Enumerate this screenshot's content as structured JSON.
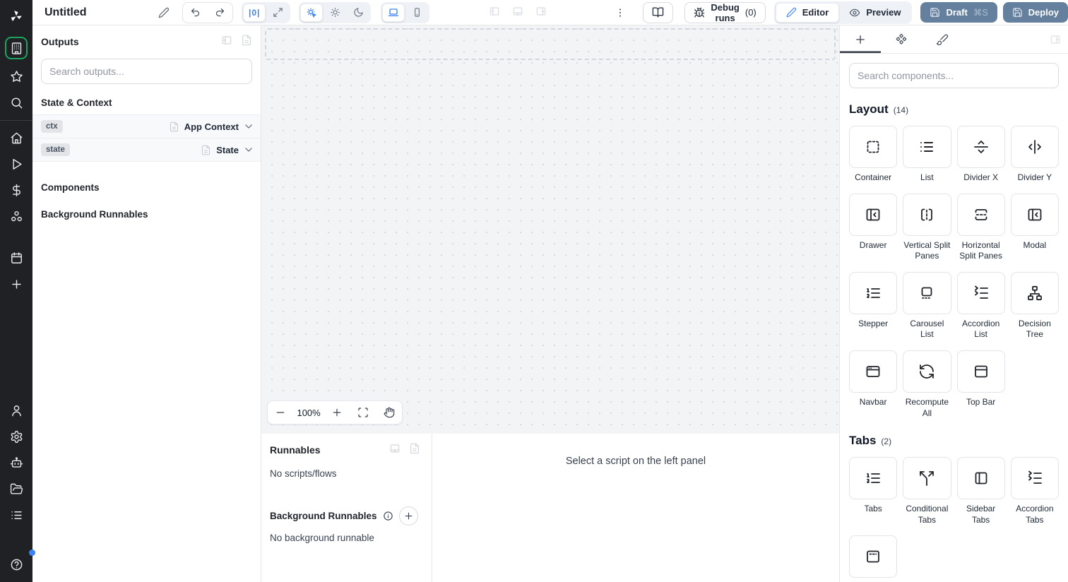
{
  "topbar": {
    "title": "Untitled",
    "zoom_width_label": "|0|",
    "debug_runs_label": "Debug runs",
    "debug_runs_count": "(0)",
    "editor_label": "Editor",
    "preview_label": "Preview",
    "draft_label": "Draft",
    "draft_shortcut": "⌘S",
    "deploy_label": "Deploy"
  },
  "rail": {
    "accent_green": "#1ba45f",
    "top": [
      {
        "icon": "building",
        "name": "apps",
        "active": true
      },
      {
        "icon": "star",
        "name": "favorites"
      },
      {
        "icon": "search",
        "name": "search"
      }
    ],
    "main": [
      {
        "icon": "home",
        "name": "home"
      },
      {
        "icon": "play",
        "name": "runs"
      },
      {
        "icon": "dollar",
        "name": "variables"
      },
      {
        "icon": "resources",
        "name": "resources"
      }
    ],
    "secondary": [
      {
        "icon": "calendar",
        "name": "schedules"
      },
      {
        "icon": "plus",
        "name": "more-triggers"
      }
    ],
    "bottom": [
      {
        "icon": "user",
        "name": "account"
      },
      {
        "icon": "gear",
        "name": "settings"
      },
      {
        "icon": "bot",
        "name": "ai"
      },
      {
        "icon": "folder",
        "name": "folders"
      },
      {
        "icon": "list",
        "name": "workers"
      }
    ],
    "help": {
      "icon": "help",
      "name": "help",
      "notification_dot": true
    }
  },
  "outputs": {
    "title": "Outputs",
    "search_placeholder": "Search outputs...",
    "state_context_heading": "State & Context",
    "rows": [
      {
        "badge": "ctx",
        "type": "App Context"
      },
      {
        "badge": "state",
        "type": "State"
      }
    ],
    "components_heading": "Components",
    "background_heading": "Background Runnables"
  },
  "canvas": {
    "zoom_level": "100%"
  },
  "runnables": {
    "title": "Runnables",
    "empty": "No scripts/flows",
    "background_title": "Background Runnables",
    "background_empty": "No background runnable",
    "hint": "Select a script on the left panel"
  },
  "components_panel": {
    "search_placeholder": "Search components...",
    "sections": [
      {
        "title": "Layout",
        "count": "(14)",
        "items": [
          {
            "label": "Container",
            "icon": "container"
          },
          {
            "label": "List",
            "icon": "list"
          },
          {
            "label": "Divider X",
            "icon": "divider-x"
          },
          {
            "label": "Divider Y",
            "icon": "divider-y"
          },
          {
            "label": "Drawer",
            "icon": "drawer"
          },
          {
            "label": "Vertical Split Panes",
            "icon": "vertical-split"
          },
          {
            "label": "Horizontal Split Panes",
            "icon": "horizontal-split"
          },
          {
            "label": "Modal",
            "icon": "drawer"
          },
          {
            "label": "Stepper",
            "icon": "list-ordered"
          },
          {
            "label": "Carousel List",
            "icon": "carousel"
          },
          {
            "label": "Accordion List",
            "icon": "accordion"
          },
          {
            "label": "Decision Tree",
            "icon": "decision-tree"
          },
          {
            "label": "Navbar",
            "icon": "navbar"
          },
          {
            "label": "Recompute All",
            "icon": "recompute"
          },
          {
            "label": "Top Bar",
            "icon": "top-bar"
          }
        ]
      },
      {
        "title": "Tabs",
        "count": "(2)",
        "items": [
          {
            "label": "Tabs",
            "icon": "list-ordered"
          },
          {
            "label": "Conditional Tabs",
            "icon": "conditional"
          },
          {
            "label": "Sidebar Tabs",
            "icon": "sidebar-tabs"
          },
          {
            "label": "Accordion Tabs",
            "icon": "accordion"
          },
          {
            "label": "",
            "icon": "dashed-top-bar"
          }
        ]
      }
    ]
  }
}
